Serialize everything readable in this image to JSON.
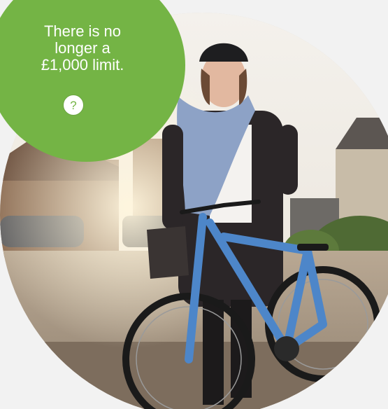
{
  "callout": {
    "line1": "There is no",
    "line2": "longer a",
    "line3": "£1,000 limit.",
    "help_label": "?",
    "color": "#74b445"
  },
  "photo": {
    "subject": "woman-with-bicycle-icon"
  }
}
